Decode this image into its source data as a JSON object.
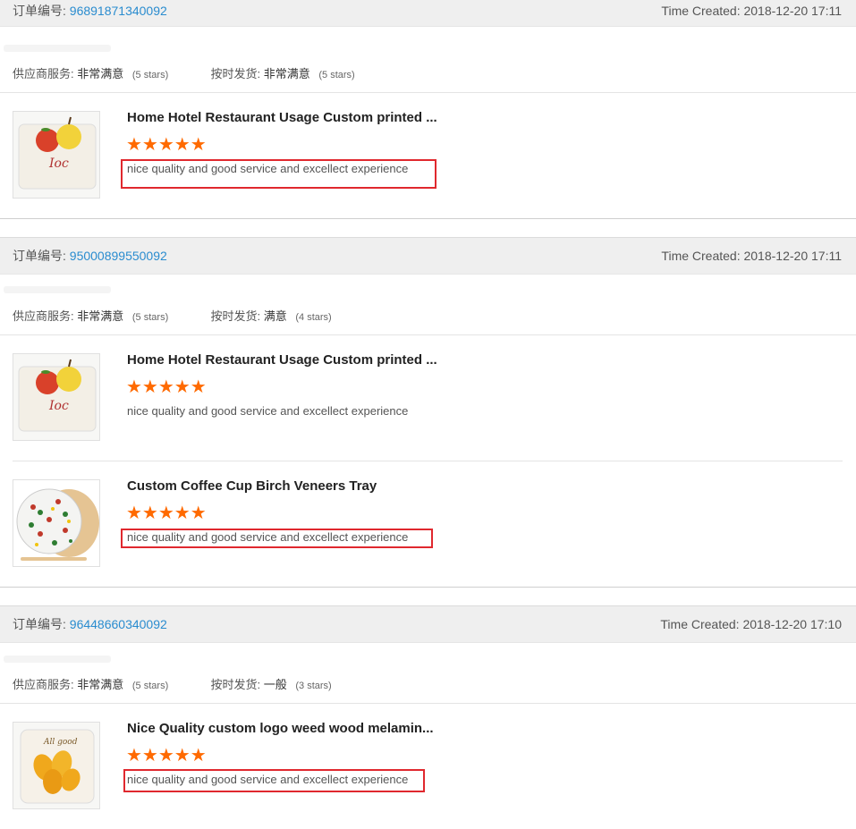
{
  "orders": [
    {
      "order_label": "订单编号:",
      "order_number": "96891871340092",
      "time_created": "Time Created: 2018-12-20 17:11",
      "supplier_service_label": "供应商服务:",
      "supplier_service_value": "非常满意",
      "supplier_service_stars": "(5 stars)",
      "ontime_label": "按时发货:",
      "ontime_value": "非常满意",
      "ontime_stars": "(5 stars)",
      "items": [
        {
          "title": "Home Hotel Restaurant Usage Custom printed ...",
          "stars": "★★★★★",
          "rating": 5,
          "review": "nice quality and good service and excellect experience"
        }
      ]
    },
    {
      "order_label": "订单编号:",
      "order_number": "95000899550092",
      "time_created": "Time Created: 2018-12-20 17:11",
      "supplier_service_label": "供应商服务:",
      "supplier_service_value": "非常满意",
      "supplier_service_stars": "(5 stars)",
      "ontime_label": "按时发货:",
      "ontime_value": "满意",
      "ontime_stars": "(4 stars)",
      "items": [
        {
          "title": "Home Hotel Restaurant Usage Custom printed ...",
          "stars": "★★★★★",
          "rating": 5,
          "review": "nice quality and good service and excellect experience"
        },
        {
          "title": "Custom Coffee Cup Birch Veneers Tray",
          "stars": "★★★★★",
          "rating": 5,
          "review": "nice quality and good service and excellect experience"
        }
      ]
    },
    {
      "order_label": "订单编号:",
      "order_number": "96448660340092",
      "time_created": "Time Created: 2018-12-20 17:10",
      "supplier_service_label": "供应商服务:",
      "supplier_service_value": "非常满意",
      "supplier_service_stars": "(5 stars)",
      "ontime_label": "按时发货:",
      "ontime_value": "一般",
      "ontime_stars": "(3 stars)",
      "items": [
        {
          "title": "Nice Quality custom logo weed wood melamin...",
          "stars": "★★★★★",
          "rating": 5,
          "review": "nice quality and good service and excellect experience"
        }
      ]
    }
  ],
  "colors": {
    "accent_star": "#ff6a00",
    "order_number": "#2a8ccf",
    "highlight": "#e0282e"
  }
}
